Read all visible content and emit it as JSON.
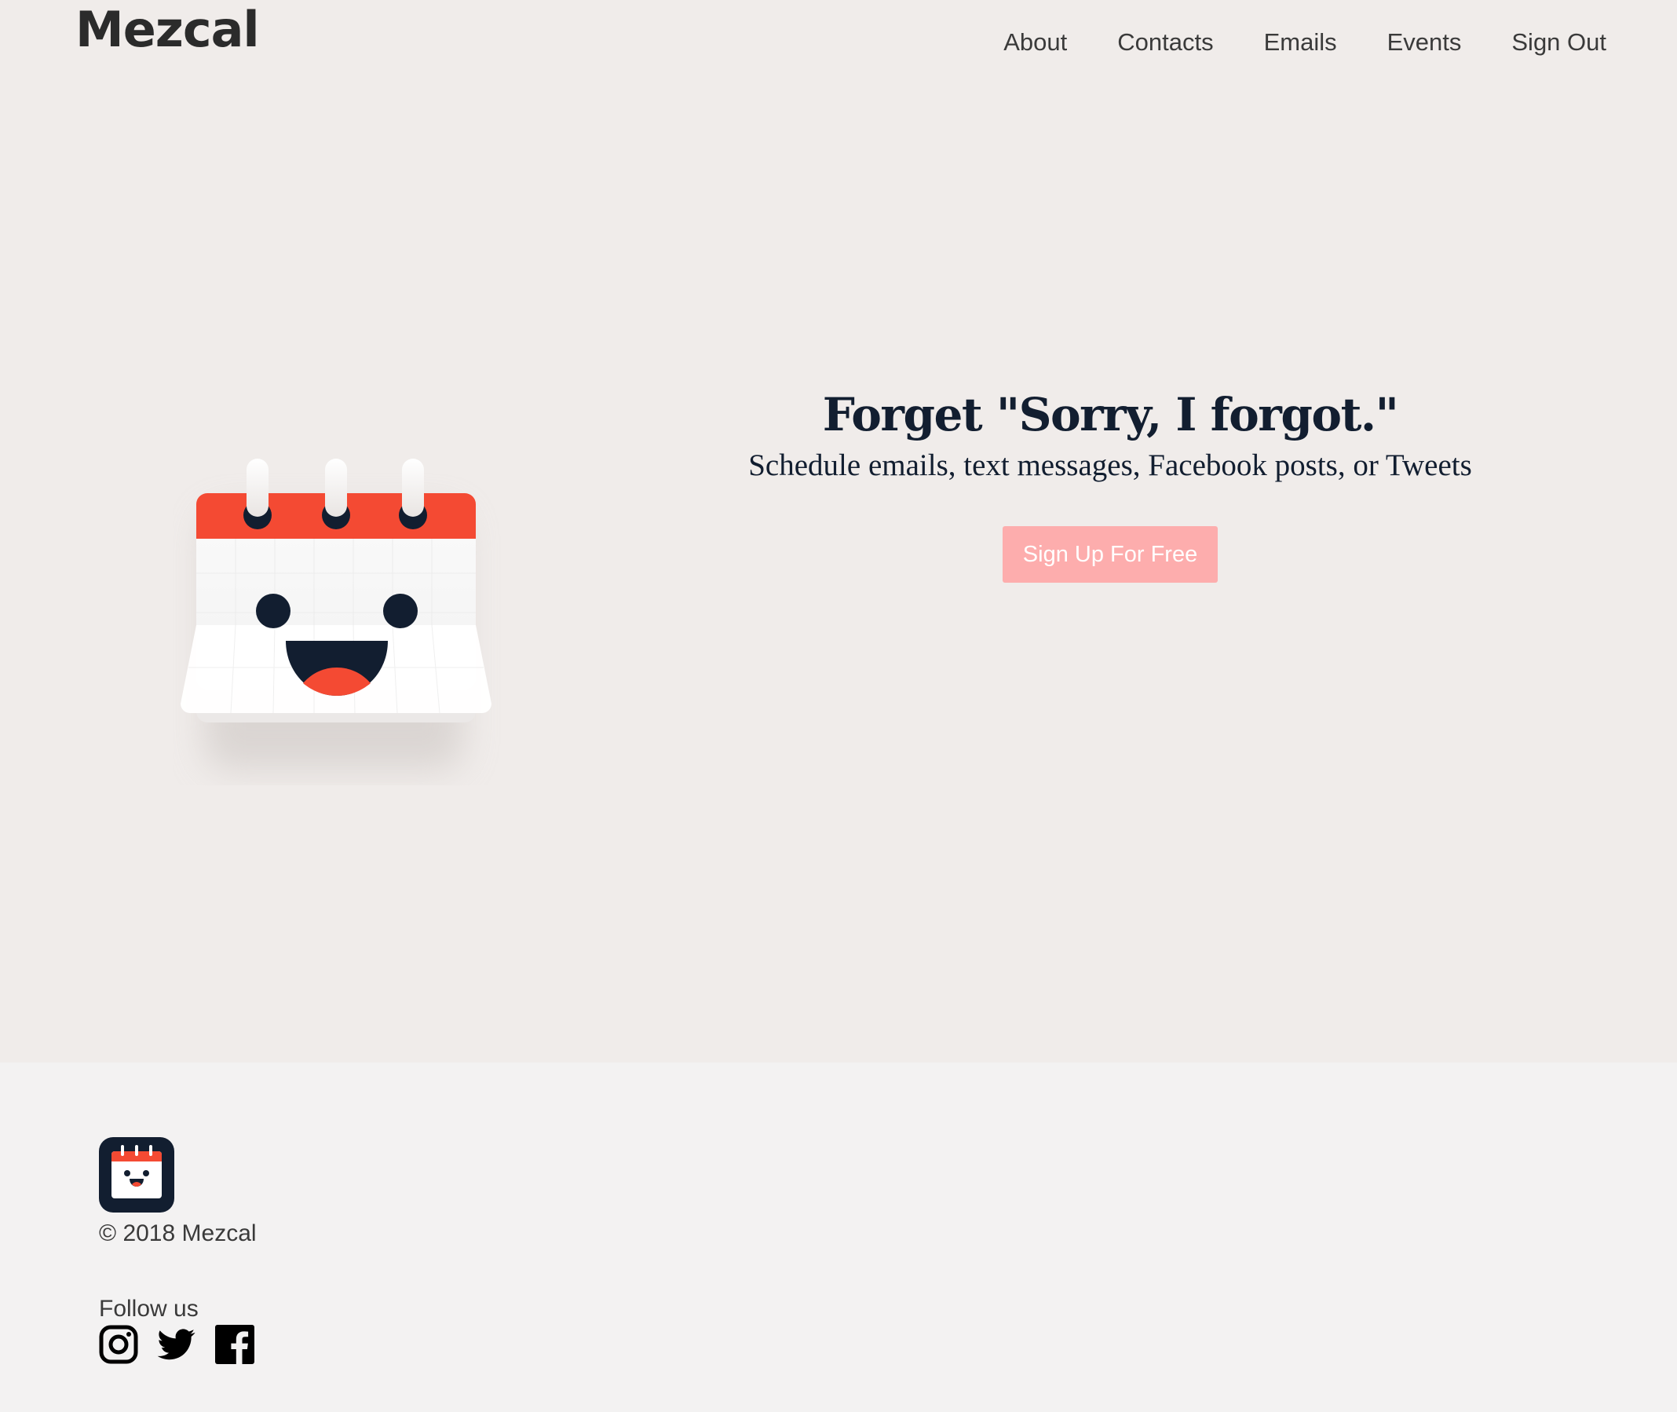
{
  "header": {
    "logo": "Mezcal",
    "nav": [
      "About",
      "Contacts",
      "Emails",
      "Events",
      "Sign Out"
    ]
  },
  "hero": {
    "headline": "Forget \"Sorry, I forgot.\"",
    "subheadline": "Schedule emails, text messages, Facebook posts, or Tweets",
    "cta_label": "Sign Up For Free"
  },
  "footer": {
    "copyright": "© 2018 Mezcal",
    "follow_label": "Follow us",
    "socials": [
      "instagram-icon",
      "twitter-icon",
      "facebook-icon"
    ]
  },
  "colors": {
    "page_bg": "#f0ecea",
    "footer_bg": "#f3f2f2",
    "accent_red": "#f44a33",
    "navy": "#121e30",
    "cta_bg": "#fdadad"
  }
}
